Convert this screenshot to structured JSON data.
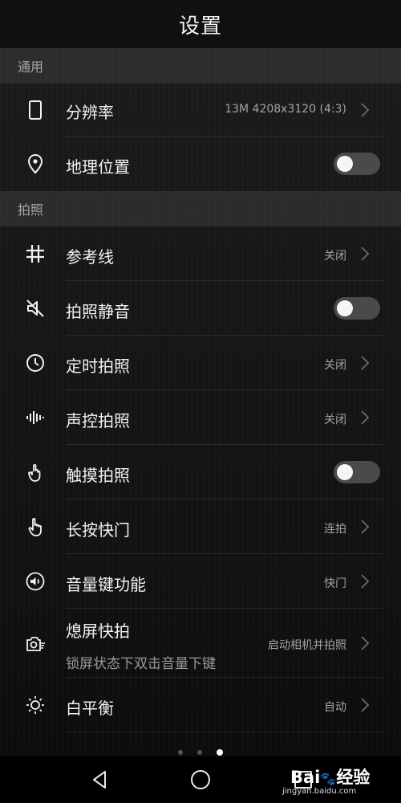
{
  "header": {
    "title": "设置"
  },
  "sections": {
    "general": {
      "label": "通用"
    },
    "photo": {
      "label": "拍照"
    }
  },
  "rows": {
    "resolution": {
      "label": "分辨率",
      "value": "13M 4208x3120 (4:3)",
      "icon": "phone-outline-icon"
    },
    "location": {
      "label": "地理位置",
      "toggle": "off",
      "icon": "location-pin-icon"
    },
    "grid": {
      "label": "参考线",
      "value": "关闭",
      "icon": "grid-icon"
    },
    "mute": {
      "label": "拍照静音",
      "toggle": "off",
      "icon": "speaker-muted-icon"
    },
    "timer": {
      "label": "定时拍照",
      "value": "关闭",
      "icon": "clock-icon"
    },
    "voice": {
      "label": "声控拍照",
      "value": "关闭",
      "icon": "sound-wave-icon"
    },
    "touch": {
      "label": "触摸拍照",
      "toggle": "off",
      "icon": "touch-finger-icon"
    },
    "longpress": {
      "label": "长按快门",
      "value": "连拍",
      "icon": "hand-press-icon"
    },
    "volumekey": {
      "label": "音量键功能",
      "value": "快门",
      "icon": "volume-icon"
    },
    "ultrasnap": {
      "label": "熄屏快拍",
      "sublabel": "锁屏状态下双击音量下键",
      "value": "启动相机并拍照",
      "icon": "camera-snap-icon"
    },
    "whitebalance": {
      "label": "白平衡",
      "value": "自动",
      "icon": "sun-icon"
    }
  },
  "pager": {
    "count": 3,
    "active_index": 2
  },
  "navbar": {
    "icons": [
      "back-icon",
      "home-icon",
      "recents-icon"
    ]
  },
  "watermark": {
    "logo_a": "Bai",
    "logo_paw": "🐾",
    "logo_b": "经验",
    "sub": "jingyan.baidu.com"
  },
  "colors": {
    "background": "#161616",
    "text": "#f2f2f2",
    "secondary": "#a4a4a4",
    "toggle_off": "#4a4a4a"
  }
}
